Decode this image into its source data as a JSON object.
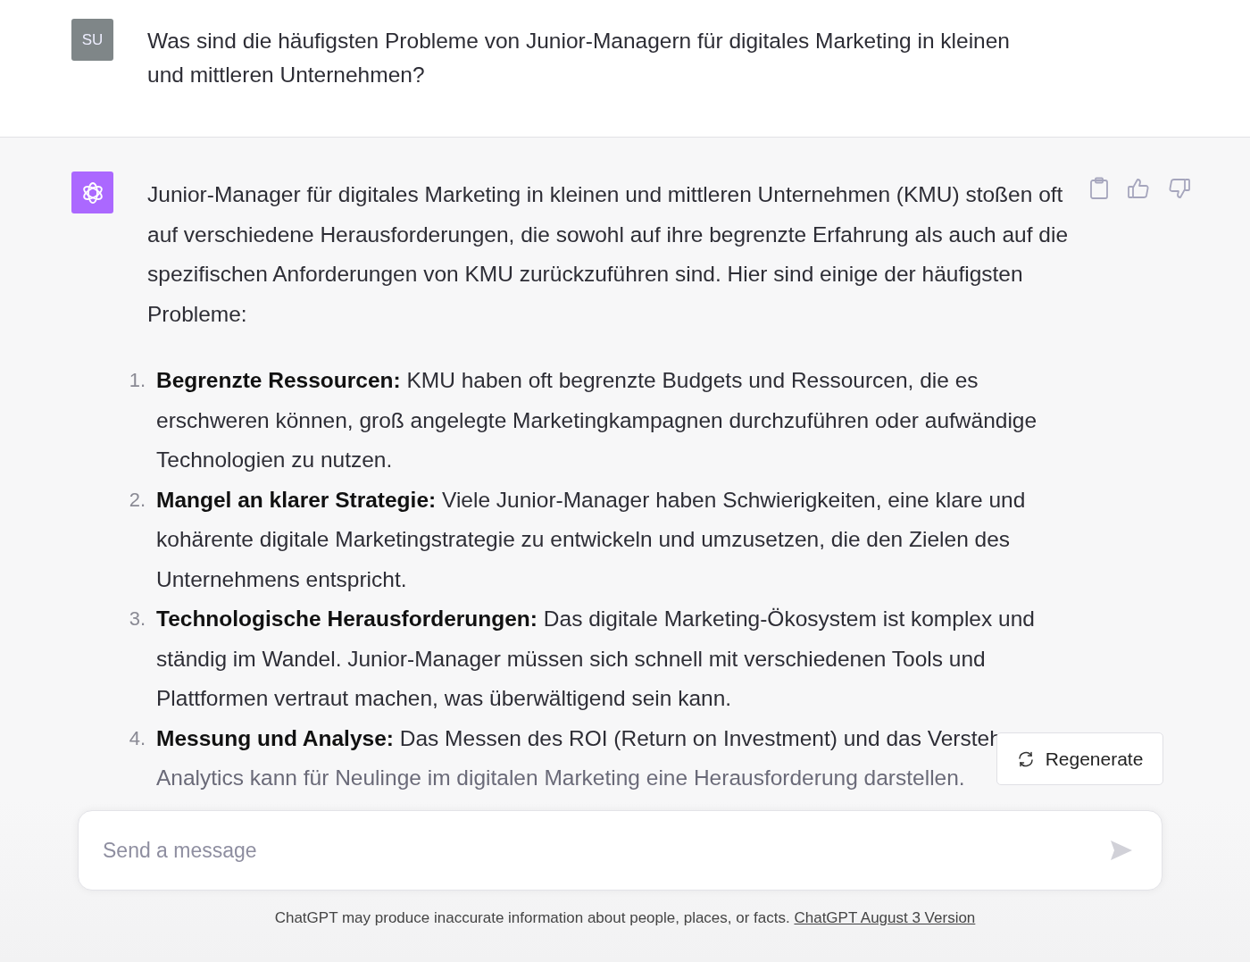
{
  "user_message": {
    "avatar": "SU",
    "text": "Was sind die häufigsten Probleme von Junior-Managern für digitales Marketing in kleinen und mittleren Unternehmen?"
  },
  "assistant_message": {
    "intro": "Junior-Manager für digitales Marketing in kleinen und mittleren Unternehmen (KMU) stoßen oft auf verschiedene Herausforderungen, die sowohl auf ihre begrenzte Erfahrung als auch auf die spezifischen Anforderungen von KMU zurückzuführen sind. Hier sind einige der häufigsten Probleme:",
    "items": [
      {
        "number": "1.",
        "title": "Begrenzte Ressourcen:",
        "text": "KMU haben oft begrenzte Budgets und Ressourcen, die es erschweren können, groß angelegte Marketingkampagnen durchzuführen oder aufwändige Technologien zu nutzen."
      },
      {
        "number": "2.",
        "title": "Mangel an klarer Strategie:",
        "text": "Viele Junior-Manager haben Schwierigkeiten, eine klare und kohärente digitale Marketingstrategie zu entwickeln und umzusetzen, die den Zielen des Unternehmens entspricht."
      },
      {
        "number": "3.",
        "title": "Technologische Herausforderungen:",
        "text": "Das digitale Marketing-Ökosystem ist komplex und ständig im Wandel. Junior-Manager müssen sich schnell mit verschiedenen Tools und Plattformen vertraut machen, was überwältigend sein kann."
      },
      {
        "number": "4.",
        "title": "Messung und Analyse:",
        "text": "Das Messen des ROI (Return on Investment) und das Versteh",
        "continuation": "Analytics kann für Neulinge im digitalen Marketing eine Herausforderung darstellen."
      }
    ]
  },
  "regenerate_button": "Regenerate",
  "composer": {
    "placeholder": "Send a message"
  },
  "footer": {
    "text": "ChatGPT may produce inaccurate information about people, places, or facts.",
    "link": "ChatGPT August 3 Version"
  }
}
